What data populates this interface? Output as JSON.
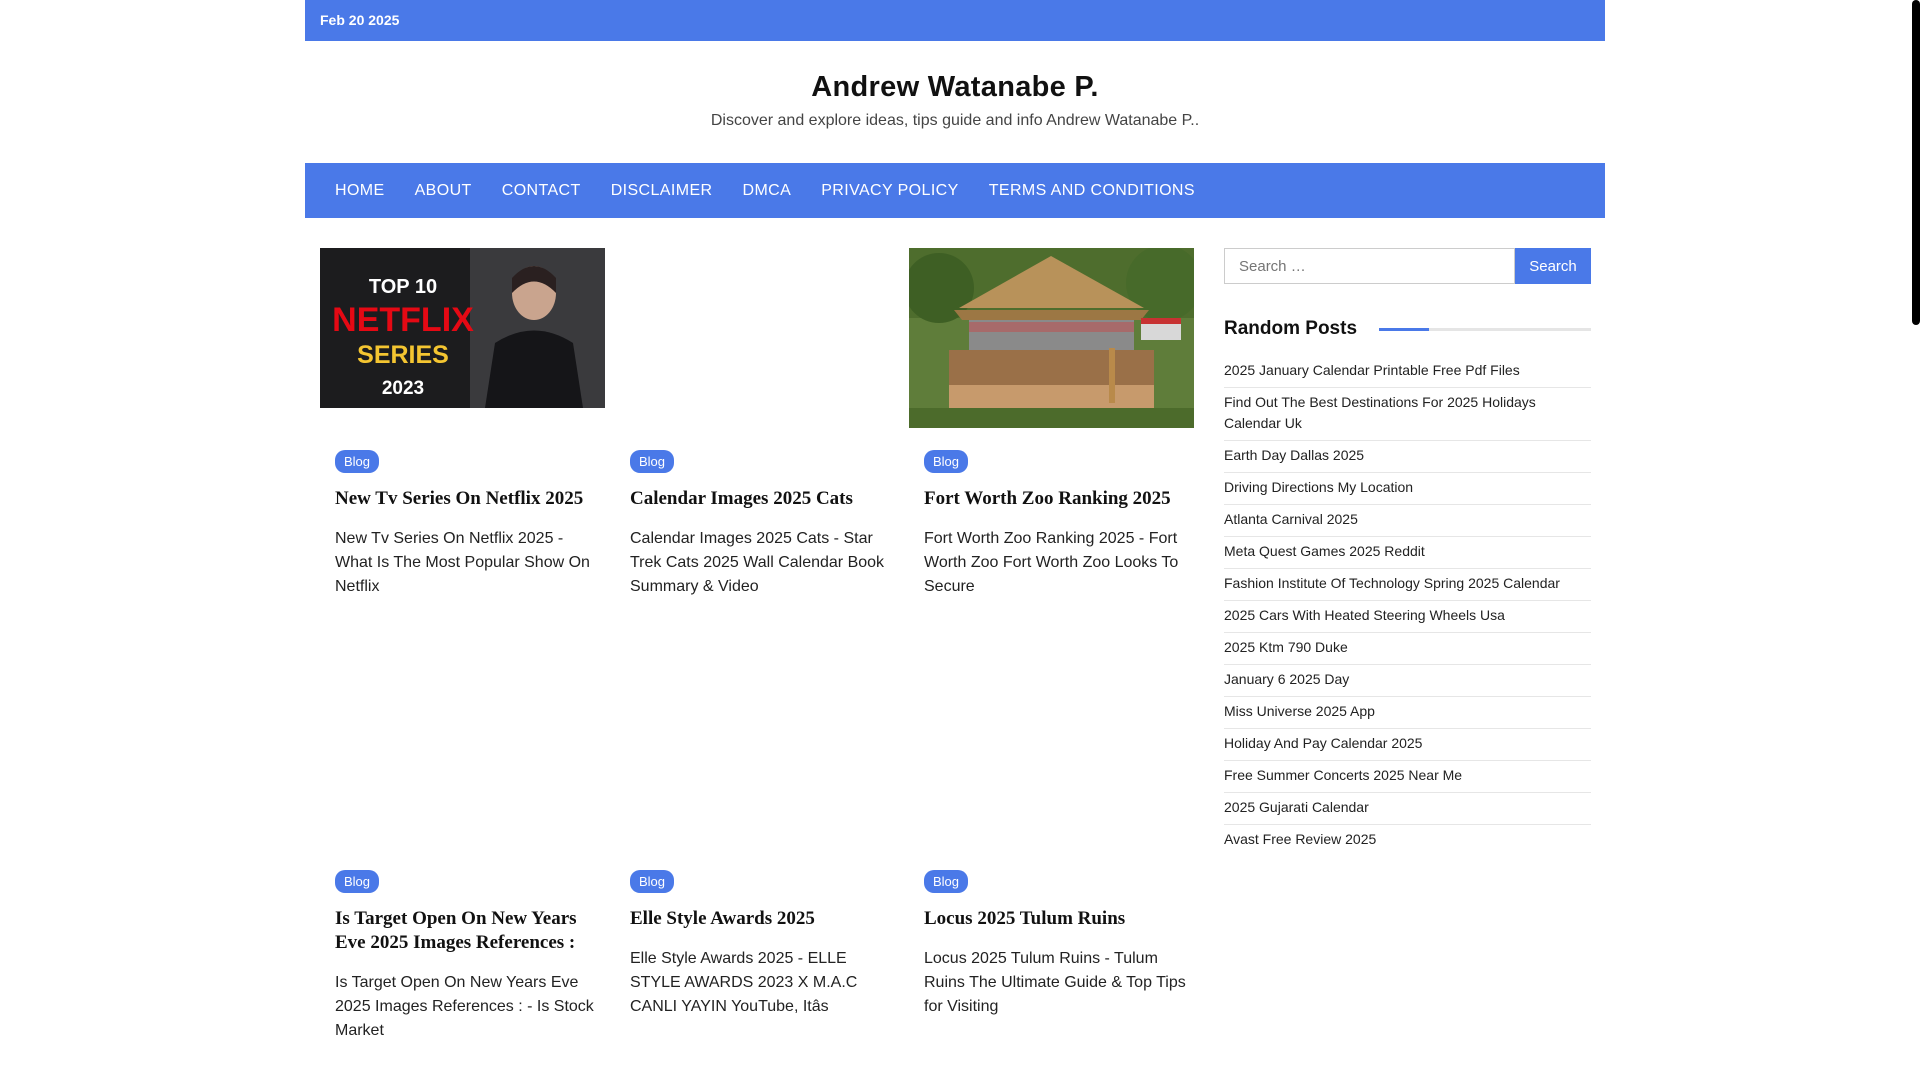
{
  "topbar": {
    "date": "Feb 20 2025"
  },
  "site": {
    "title": "Andrew Watanabe P.",
    "description": "Discover and explore ideas, tips guide and info Andrew Watanabe P.."
  },
  "nav": [
    "HOME",
    "ABOUT",
    "CONTACT",
    "DISCLAIMER",
    "DMCA",
    "PRIVACY POLICY",
    "TERMS AND CONDITIONS"
  ],
  "posts": [
    {
      "category": "Blog",
      "title": "New Tv Series On Netflix 2025",
      "excerpt": "New Tv Series On Netflix 2025 - What Is The Most Popular Show On Netflix",
      "thumb_caption": "TOP 10 NETFLIX SERIES 2023"
    },
    {
      "category": "Blog",
      "title": "Calendar Images 2025 Cats",
      "excerpt": "Calendar Images 2025 Cats - Star Trek Cats 2025 Wall Calendar Book Summary & Video"
    },
    {
      "category": "Blog",
      "title": "Fort Worth Zoo Ranking 2025",
      "excerpt": "Fort Worth Zoo Ranking 2025 - Fort Worth Zoo Fort Worth Zoo Looks To Secure"
    },
    {
      "category": "Blog",
      "title": "Is Target Open On New Years Eve 2025 Images References :",
      "excerpt": "Is Target Open On New Years Eve 2025 Images References : - Is Stock Market"
    },
    {
      "category": "Blog",
      "title": "Elle Style Awards 2025",
      "excerpt": "Elle Style Awards 2025 - ELLE STYLE AWARDS 2023 X M.A.C CANLI YAYIN YouTube, Itâs"
    },
    {
      "category": "Blog",
      "title": "Locus 2025 Tulum Ruins",
      "excerpt": "Locus 2025 Tulum Ruins - Tulum Ruins The Ultimate Guide & Top Tips for Visiting"
    }
  ],
  "sidebar": {
    "search_placeholder": "Search …",
    "search_button": "Search",
    "random_title": "Random Posts",
    "random_posts": [
      "2025 January Calendar Printable Free Pdf Files",
      "Find Out The Best Destinations For 2025 Holidays Calendar Uk",
      "Earth Day Dallas 2025",
      "Driving Directions My Location",
      "Atlanta Carnival 2025",
      "Meta Quest Games 2025 Reddit",
      "Fashion Institute Of Technology Spring 2025 Calendar",
      "2025 Cars With Heated Steering Wheels Usa",
      "2025 Ktm 790 Duke",
      "January 6 2025 Day",
      "Miss Universe 2025 App",
      "Holiday And Pay Calendar 2025",
      "Free Summer Concerts 2025 Near Me",
      "2025 Gujarati Calendar",
      "Avast Free Review 2025"
    ]
  }
}
